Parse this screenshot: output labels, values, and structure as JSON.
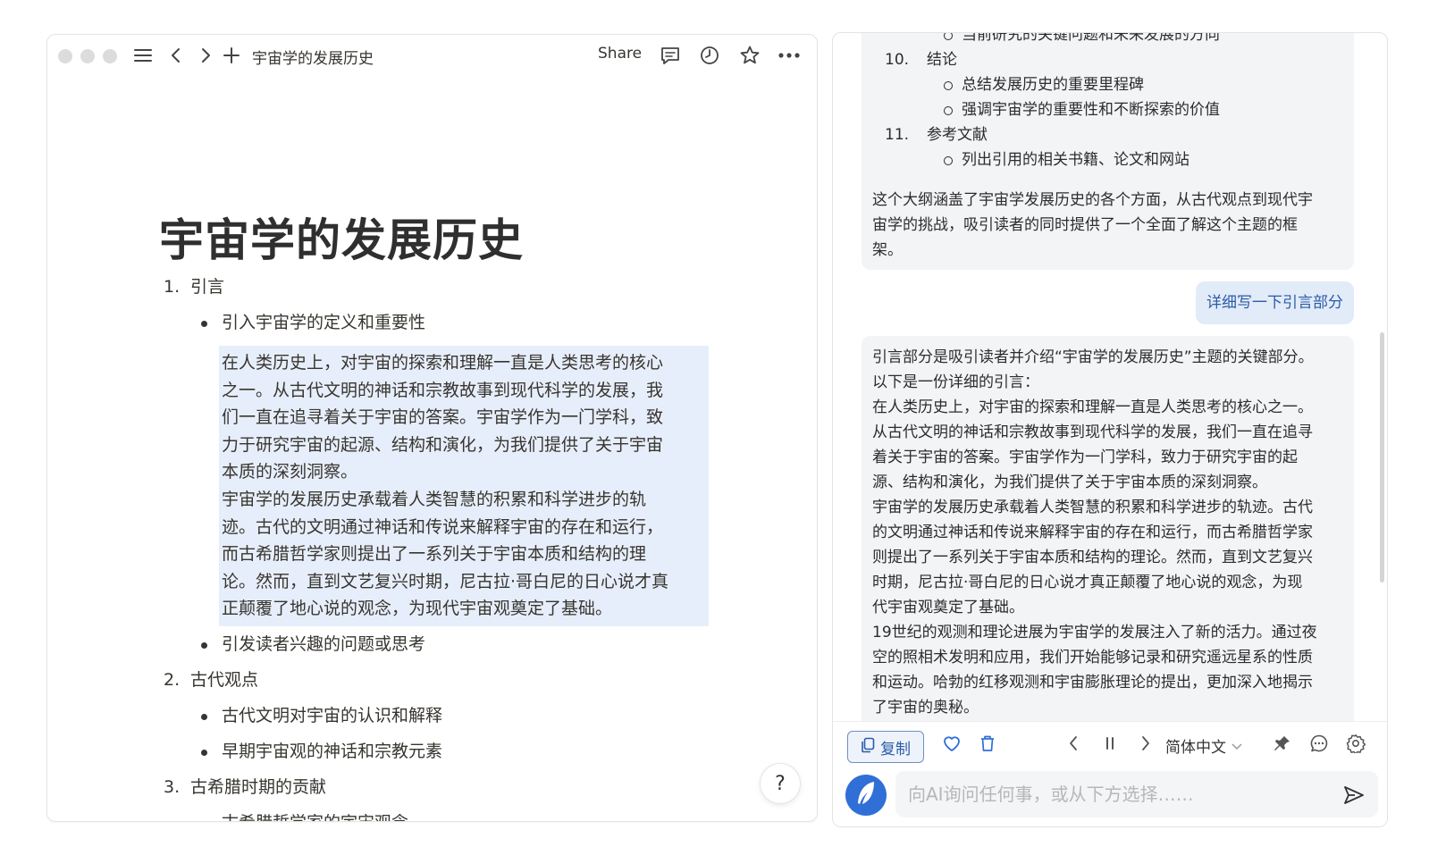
{
  "doc": {
    "tab_title": "宇宙学的发展历史",
    "share_label": "Share",
    "title": "宇宙学的发展历史",
    "sections": [
      {
        "num": "1.",
        "label": "引言"
      },
      {
        "num": "2.",
        "label": "古代观点"
      },
      {
        "num": "3.",
        "label": "古希腊时期的贡献"
      }
    ],
    "bullets": {
      "s1_b1": "引入宇宙学的定义和重要性",
      "s1_b2": "引发读者兴趣的问题或思考",
      "s2_b1": "古代文明对宇宙的认识和解释",
      "s2_b2": "早期宇宙观的神话和宗教元素",
      "s3_b1": "古希腊哲学家的宇宙观念"
    },
    "quote_lines": [
      "在人类历史上，对宇宙的探索和理解一直是人类思考的核心",
      "之一。从古代文明的神话和宗教故事到现代科学的发展，我",
      "们一直在追寻着关于宇宙的答案。宇宙学作为一门学科，致",
      "力于研究宇宙的起源、结构和演化，为我们提供了关于宇宙",
      "本质的深刻洞察。",
      "宇宙学的发展历史承载着人类智慧的积累和科学进步的轨",
      "迹。古代的文明通过神话和传说来解释宇宙的存在和运行，",
      "而古希腊哲学家则提出了一系列关于宇宙本质和结构的理",
      "论。然而，直到文艺复兴时期，尼古拉·哥白尼的日心说才真",
      "正颠覆了地心说的观念，为现代宇宙观奠定了基础。"
    ],
    "help_label": "?"
  },
  "chat": {
    "msg1": {
      "top_cut": "当前研究的关键问题和未来发展的方向",
      "items": [
        {
          "num": "10.",
          "label": "结论",
          "subs": [
            "总结发展历史的重要里程碑",
            "强调宇宙学的重要性和不断探索的价值"
          ]
        },
        {
          "num": "11.",
          "label": "参考文献",
          "subs": [
            "列出引用的相关书籍、论文和网站"
          ]
        }
      ],
      "summary_lines": [
        "这个大纲涵盖了宇宙学发展历史的各个方面，从古代观点到现代宇",
        "宙学的挑战，吸引读者的同时提供了一个全面了解这个主题的框",
        "架。"
      ]
    },
    "user_msg": "详细写一下引言部分",
    "msg2_lines": [
      "引言部分是吸引读者并介绍“宇宙学的发展历史”主题的关键部分。",
      "以下是一份详细的引言：",
      "在人类历史上，对宇宙的探索和理解一直是人类思考的核心之一。",
      "从古代文明的神话和宗教故事到现代科学的发展，我们一直在追寻",
      "着关于宇宙的答案。宇宙学作为一门学科，致力于研究宇宙的起",
      "源、结构和演化，为我们提供了关于宇宙本质的深刻洞察。",
      "宇宙学的发展历史承载着人类智慧的积累和科学进步的轨迹。古代",
      "的文明通过神话和传说来解释宇宙的存在和运行，而古希腊哲学家",
      "则提出了一系列关于宇宙本质和结构的理论。然而，直到文艺复兴",
      "时期，尼古拉·哥白尼的日心说才真正颠覆了地心说的观念，为现",
      "代宇宙观奠定了基础。",
      "19世纪的观测和理论进展为宇宙学的发展注入了新的活力。通过夜",
      "空的照相术发明和应用，我们开始能够记录和研究遥远星系的性质",
      "和运动。哈勃的红移观测和宇宙膨胀理论的提出，更加深入地揭示",
      "了宇宙的奥秘。"
    ],
    "actions": {
      "copy_label": "复制",
      "language": "简体中文"
    },
    "input_placeholder": "向AI询问任何事，或从下方选择……"
  },
  "colors": {
    "highlight": "#e7eefb",
    "accent": "#2a5ba8",
    "logo_bg": "#2f6fd6"
  },
  "icons": [
    "menu-icon",
    "back-icon",
    "forward-icon",
    "plus-icon",
    "comment-icon",
    "history-icon",
    "star-icon",
    "more-icon",
    "copy-icon",
    "heart-icon",
    "trash-icon",
    "prev-icon",
    "pause-icon",
    "next-icon",
    "chevron-down-icon",
    "pin-icon",
    "chat-icon",
    "gear-icon",
    "feather-icon",
    "send-icon"
  ]
}
